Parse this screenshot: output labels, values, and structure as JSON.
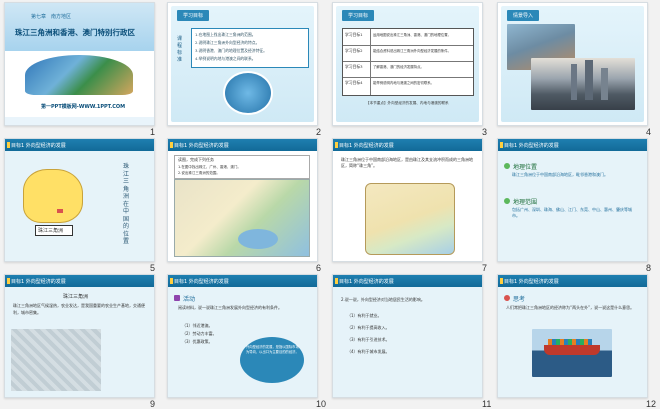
{
  "slides": [
    {
      "number": "1",
      "chapter": "第七章　南方地区",
      "title": "珠江三角洲和香港、澳门特别行政区",
      "footer": "第一PPT模板网-WWW.1PPT.COM"
    },
    {
      "number": "2",
      "tag": "学习目标",
      "side_label": "课程标准",
      "lines": [
        "1.在地图上找出珠江三角洲的范围。",
        "2.说明珠江三角洲外向型经济的特点。",
        "3.说明香港、澳门的地理位置及经济特征。",
        "4.举例说明内地与港澳之间的联系。"
      ]
    },
    {
      "number": "3",
      "tag": "学习目标",
      "rows": [
        "学习目标1",
        "学习目标2",
        "学习目标3",
        "学习目标4"
      ],
      "row_text": [
        "运用地图说出珠江三角洲、香港、澳门的地理位置。",
        "能结合资料说出珠江三角洲外向型经济发展的条件。",
        "了解香港、澳门的经济发展特点。",
        "能举例说明内地与港澳之间的密切联系。"
      ],
      "note": "【本节重点】外向型经济的发展、内地与港澳的联系"
    },
    {
      "number": "4",
      "tag": "情景导入"
    },
    {
      "number": "5",
      "header": "目标1 外向型经济的发展",
      "map_label": "珠江三角洲",
      "vertical_text": "珠江三角洲在中国的位置"
    },
    {
      "number": "6",
      "header": "目标1 外向型经济的发展",
      "box_title": "读图，完成下列任务",
      "box_lines": [
        "1.在图中找出珠江、广州、香港、澳门。",
        "2.说出珠江三角洲的范围。"
      ]
    },
    {
      "number": "7",
      "header": "目标1 外向型经济的发展",
      "intro": "珠江三角洲位于中国南部沿海地区，是由珠江及其支流冲积而成的三角洲地区，简称“珠三角”。"
    },
    {
      "number": "8",
      "header": "目标1 外向型经济的发展",
      "items": [
        {
          "title": "地理位置",
          "text": "珠江三角洲位于中国南部沿海地区，毗邻香港和澳门。"
        },
        {
          "title": "地理范围",
          "text": "包括广州、深圳、珠海、佛山、江门、东莞、中山、惠州、肇庆等城市。"
        }
      ]
    },
    {
      "number": "9",
      "header": "目标1 外向型经济的发展",
      "caption": "珠江三角洲",
      "text": "珠江三角洲地区气候湿热，农业发达，是我国重要的农业生产基地，交通便利，城市密集。"
    },
    {
      "number": "10",
      "header": "目标1 外向型经济的发展",
      "activity_label": "活动",
      "lines": [
        "阅读材料，说一说珠江三角洲发展外向型经济的有利条件。",
        "（1）邻近港澳。",
        "（2）劳动力丰富。",
        "（3）优惠政策。"
      ],
      "bubble": "外向型经济的发展，是指以国际市场为导向，以出口为主要目的的经济。"
    },
    {
      "number": "11",
      "header": "目标1 外向型经济的发展",
      "lines": [
        "2.说一说，外向型经济对当地居民生活的影响。",
        "（1）有利于就业。",
        "（2）有利于提高收入。",
        "（3）有利于引进技术。",
        "（4）有利于城市发展。"
      ]
    },
    {
      "number": "12",
      "header": "目标1 外向型经济的发展",
      "think_label": "思考",
      "text": "人们常把珠江三角洲地区的经济称为“两头在外”，说一说这是什么意思。"
    }
  ]
}
